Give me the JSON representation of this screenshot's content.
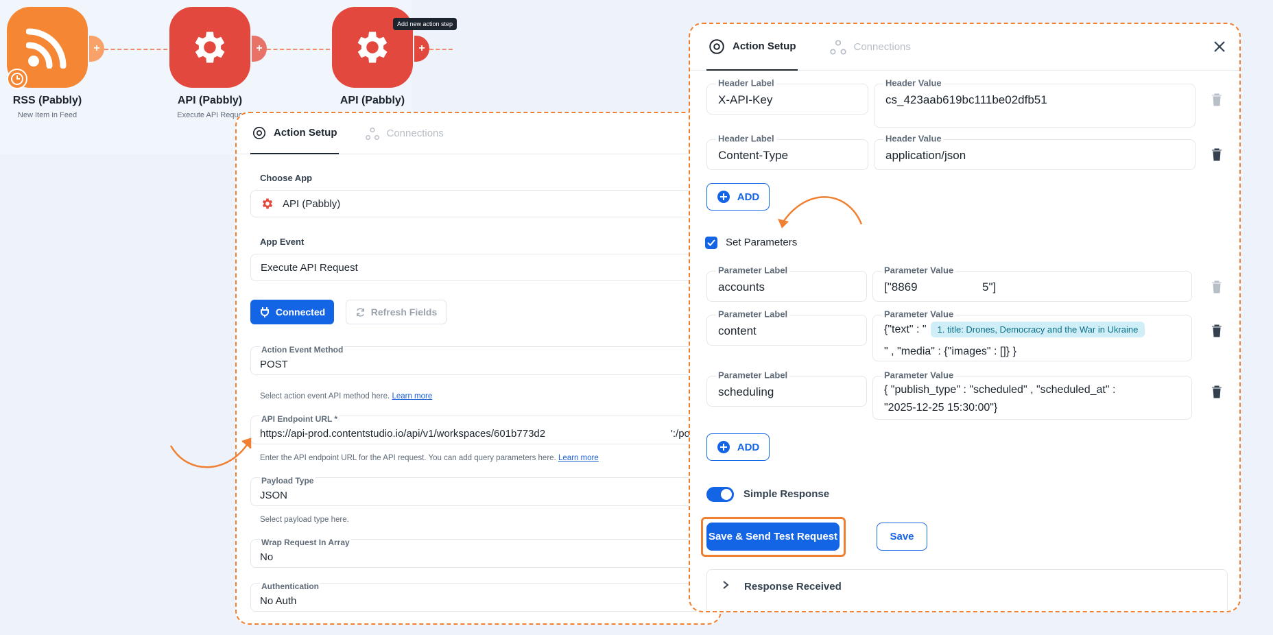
{
  "workflow": {
    "nodes": [
      {
        "title": "RSS (Pabbly)",
        "subtitle": "New Item in Feed"
      },
      {
        "title": "API (Pabbly)",
        "subtitle": "Execute API Reque"
      },
      {
        "title": "API (Pabbly)",
        "subtitle": ""
      }
    ],
    "plus": "+",
    "tooltip": "Add new action step"
  },
  "left_panel": {
    "tabs": {
      "action_setup": "Action Setup",
      "connections": "Connections"
    },
    "choose_app_label": "Choose App",
    "choose_app_value": "API (Pabbly)",
    "app_event_label": "App Event",
    "app_event_value": "Execute API Request",
    "connected_label": "Connected",
    "refresh_label": "Refresh Fields",
    "method_label": "Action Event Method",
    "method_value": "POST",
    "method_hint": "Select action event API method here.",
    "learn_more": "Learn more",
    "endpoint_label": "API Endpoint URL *",
    "endpoint_value_a": "https://api-prod.contentstudio.io/api/v1/workspaces/601b773d2",
    "endpoint_value_b": "':/posts",
    "endpoint_hint": "Enter the API endpoint URL for the API request. You can add query parameters here.",
    "payload_label": "Payload Type",
    "payload_value": "JSON",
    "payload_hint": "Select payload type here.",
    "wrap_label": "Wrap Request In Array",
    "wrap_value": "No",
    "auth_label": "Authentication",
    "auth_value": "No Auth"
  },
  "right_panel": {
    "tabs": {
      "action_setup": "Action Setup",
      "connections": "Connections"
    },
    "headers": [
      {
        "label_title": "Header Label",
        "label": "X-API-Key",
        "value_title": "Header Value",
        "value": "cs_423aab619bc111be02dfb51"
      },
      {
        "label_title": "Header Label",
        "label": "Content-Type",
        "value_title": "Header Value",
        "value": "application/json"
      }
    ],
    "add_label": "ADD",
    "set_parameters_label": "Set Parameters",
    "params": [
      {
        "label_title": "Parameter Label",
        "label": "accounts",
        "value_title": "Parameter Value",
        "value": "[\"8869                    5\"]"
      },
      {
        "label_title": "Parameter Label",
        "label": "content",
        "value_title": "Parameter Value",
        "value_prefix": "{\"text\" : \"",
        "chip": "1. title: Drones, Democracy and the War in Ukraine",
        "value_suffix": "\" , \"media\" : {\"images\" : []} }"
      },
      {
        "label_title": "Parameter Label",
        "label": "scheduling",
        "value_title": "Parameter Value",
        "value_line1": "{ \"publish_type\" : \"scheduled\" , \"scheduled_at\" :",
        "value_line2": "\"2025-12-25 15:30:00\"}"
      }
    ],
    "simple_response_label": "Simple Response",
    "save_send_label": "Save & Send Test Request",
    "save_label": "Save",
    "response_received_label": "Response Received"
  },
  "colors": {
    "accent": "#1464e6",
    "annotation": "#f08030",
    "rss": "#f58634",
    "api": "#e2483d"
  }
}
